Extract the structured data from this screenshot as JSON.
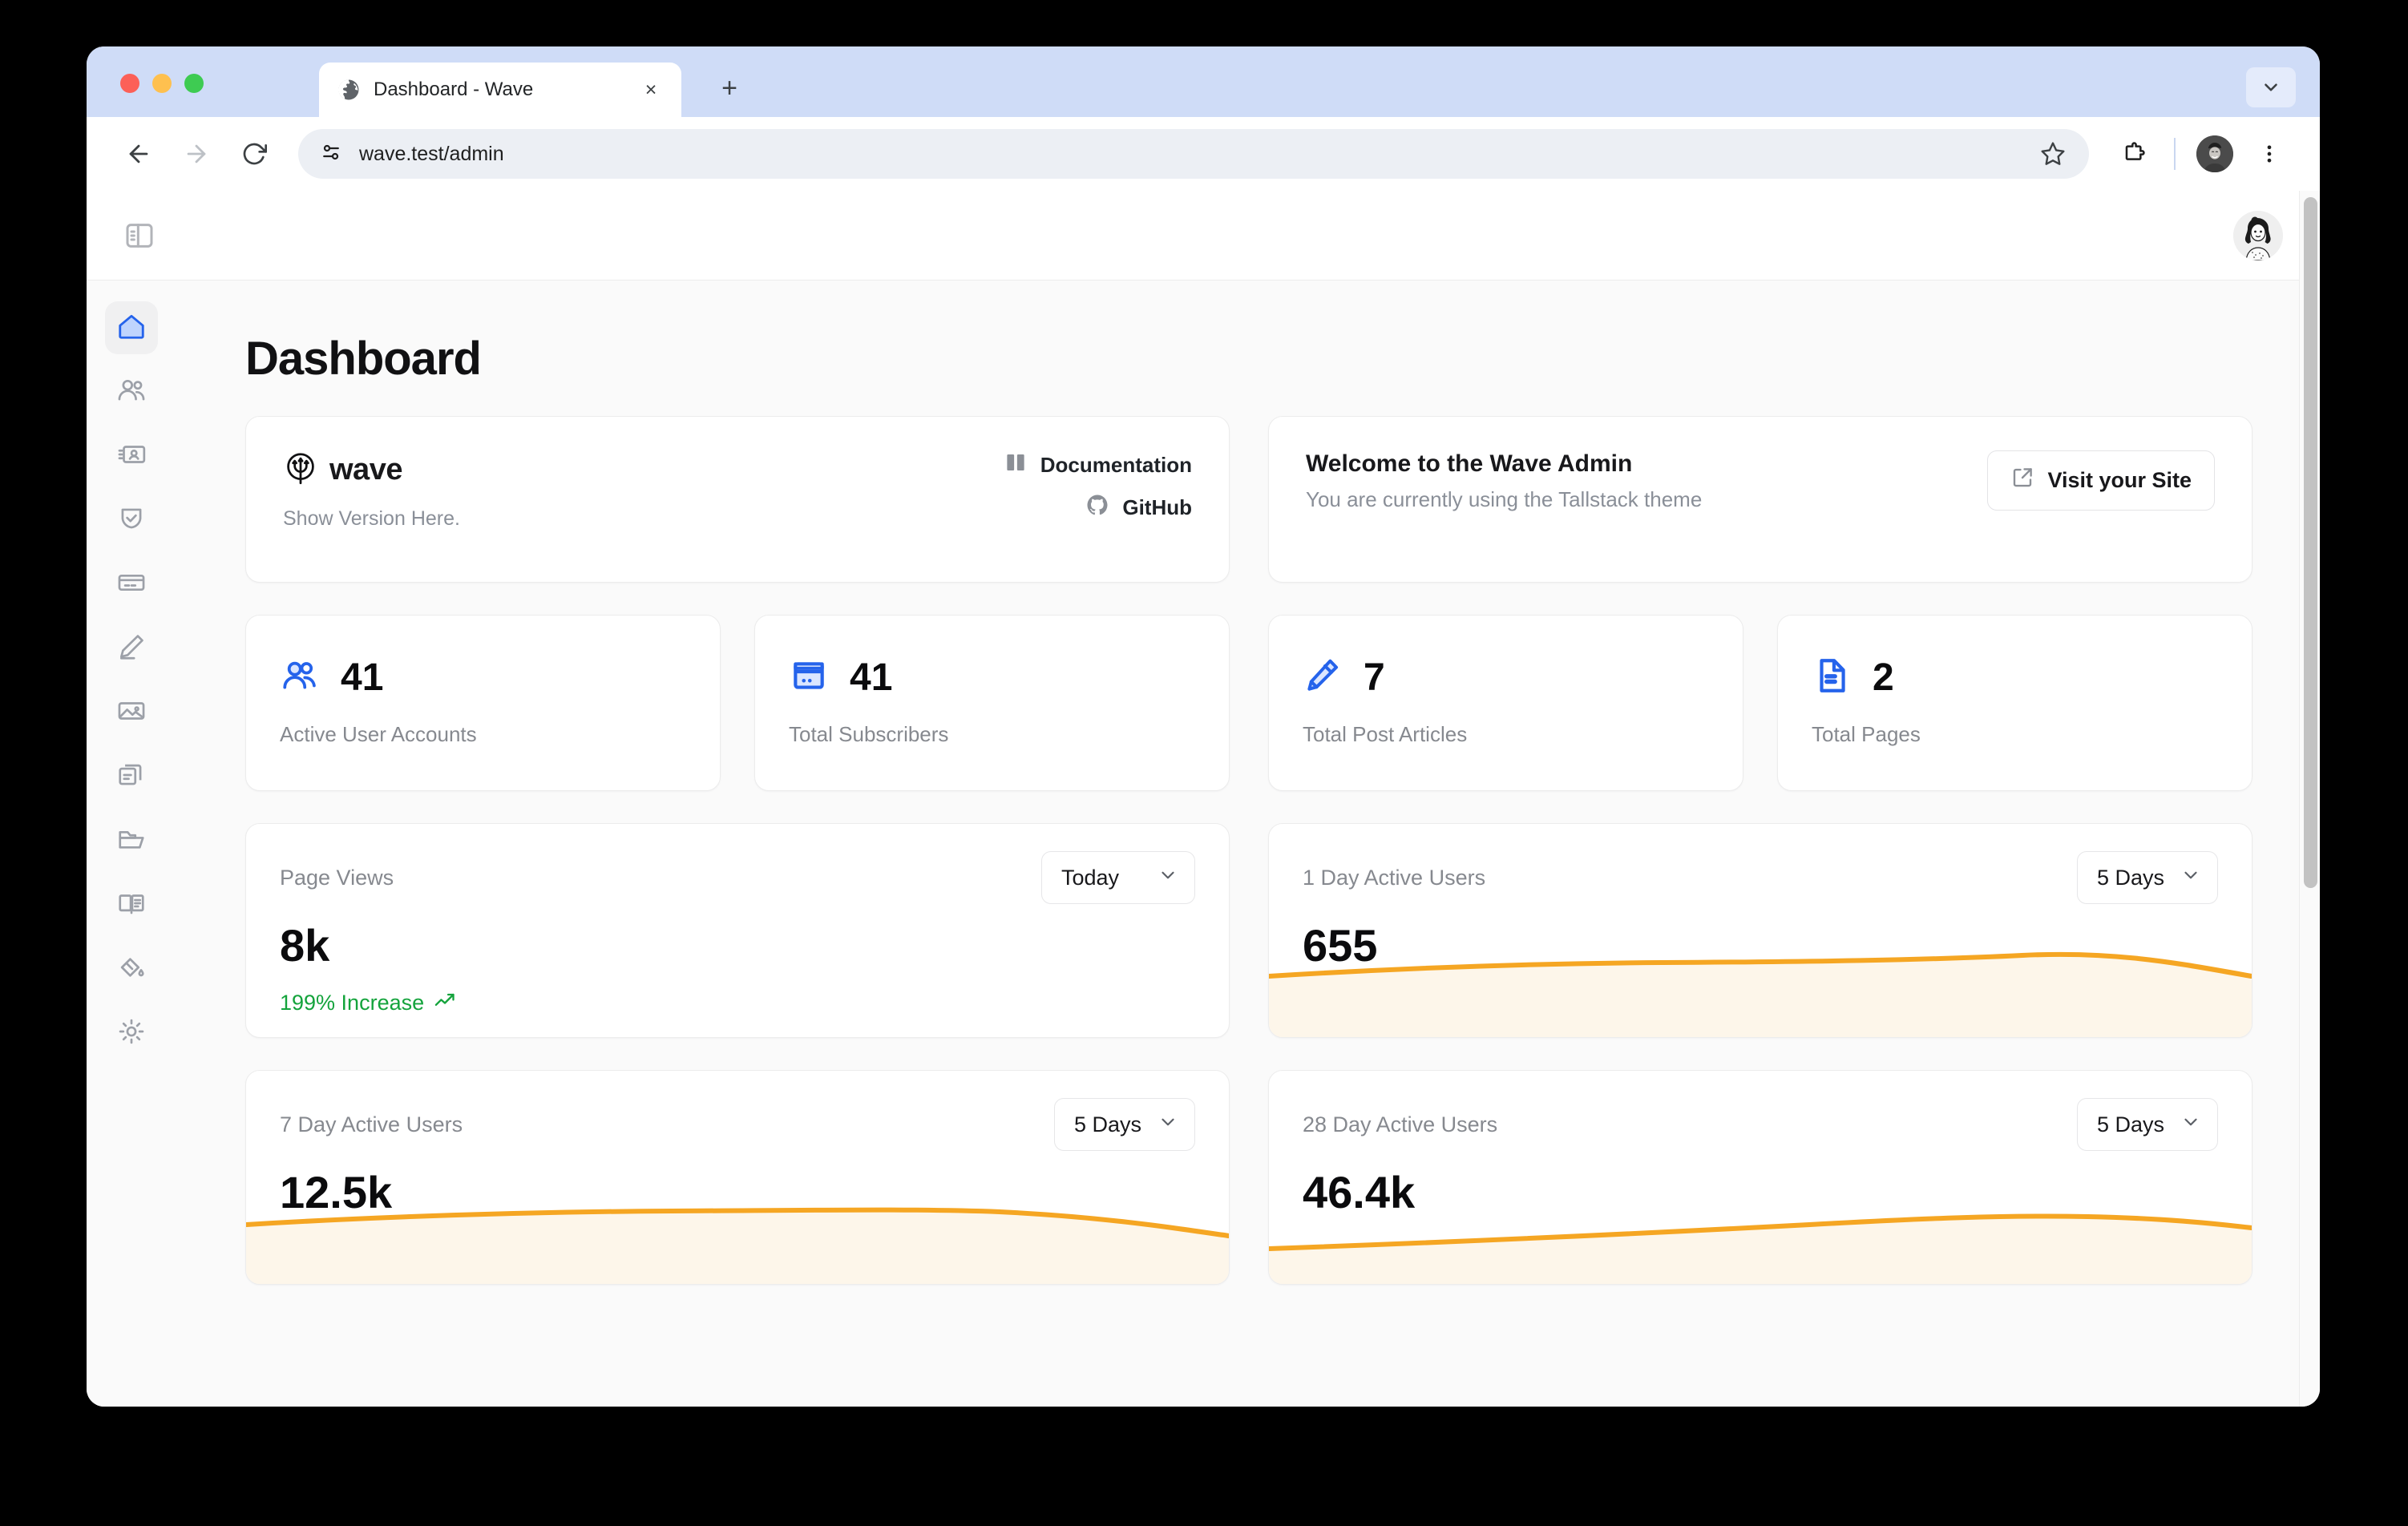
{
  "browser": {
    "tab": {
      "title": "Dashboard - Wave",
      "favicon": "globe-icon",
      "close": "×"
    },
    "new_tab": "+",
    "address": "wave.test/admin",
    "reload_glyph": "⟳",
    "back_glyph": "←",
    "forward_glyph": "→"
  },
  "app": {
    "topbar": {
      "panel_toggle_icon": "sidebar-toggle-icon",
      "avatar_alt": "User avatar"
    },
    "sidebar": {
      "items": [
        {
          "name": "home",
          "label": "Dashboard",
          "active": true
        },
        {
          "name": "users",
          "label": "Users",
          "active": false
        },
        {
          "name": "id-card",
          "label": "Profiles",
          "active": false
        },
        {
          "name": "shield-check",
          "label": "Roles",
          "active": false
        },
        {
          "name": "credit-card",
          "label": "Billing",
          "active": false
        },
        {
          "name": "pencil",
          "label": "Posts",
          "active": false
        },
        {
          "name": "image",
          "label": "Media",
          "active": false
        },
        {
          "name": "documents",
          "label": "Pages",
          "active": false
        },
        {
          "name": "folder",
          "label": "Categories",
          "active": false
        },
        {
          "name": "book-open",
          "label": "Docs",
          "active": false
        },
        {
          "name": "paint-bucket",
          "label": "Themes",
          "active": false
        },
        {
          "name": "gear",
          "label": "Settings",
          "active": false
        }
      ]
    },
    "page_title": "Dashboard",
    "brand_card": {
      "logo_icon": "wave-trident-logo",
      "name": "wave",
      "version": "Show Version Here.",
      "links": [
        {
          "icon": "book-icon",
          "label": "Documentation"
        },
        {
          "icon": "github-icon",
          "label": "GitHub"
        }
      ]
    },
    "welcome_card": {
      "title": "Welcome to the Wave Admin",
      "subtitle": "You are currently using the Tallstack theme",
      "button": {
        "icon": "external-link-icon",
        "label": "Visit your Site"
      }
    },
    "stats": [
      {
        "icon": "users-icon",
        "value": "41",
        "label": "Active User Accounts"
      },
      {
        "icon": "credit-card-icon",
        "value": "41",
        "label": "Total Subscribers"
      },
      {
        "icon": "pencil-icon",
        "value": "7",
        "label": "Total Post Articles"
      },
      {
        "icon": "document-icon",
        "value": "2",
        "label": "Total Pages"
      }
    ],
    "metrics": [
      {
        "label": "Page Views",
        "value": "8k",
        "delta": "199% Increase",
        "delta_icon": "trend-up-icon",
        "dropdown": "Today",
        "has_chart": false
      },
      {
        "label": "1 Day Active Users",
        "value": "655",
        "dropdown": "5 Days",
        "has_chart": true
      },
      {
        "label": "7 Day Active Users",
        "value": "12.5k",
        "dropdown": "5 Days",
        "has_chart": true
      },
      {
        "label": "28 Day Active Users",
        "value": "46.4k",
        "dropdown": "5 Days",
        "has_chart": true
      }
    ],
    "colors": {
      "accent": "#2563eb",
      "spark_line": "#f5a623",
      "spark_fill": "#fdf6ea",
      "positive": "#14a33c",
      "muted_text": "#86898f"
    }
  },
  "chart_data": [
    {
      "type": "line",
      "title": "1 Day Active Users",
      "x": [
        0,
        1,
        2,
        3,
        4
      ],
      "values": [
        640,
        660,
        668,
        672,
        620
      ],
      "series": [
        {
          "name": "1 Day Active Users",
          "values": [
            640,
            660,
            668,
            672,
            620
          ]
        }
      ],
      "xlabel": "",
      "ylabel": "",
      "grid": false,
      "legend": "none",
      "latest_value": 655,
      "range_label": "5 Days",
      "line_color": "#f5a623",
      "fill_color": "#fdf6ea"
    },
    {
      "type": "line",
      "title": "7 Day Active Users",
      "x": [
        0,
        1,
        2,
        3,
        4
      ],
      "values": [
        12200,
        12550,
        12600,
        12580,
        12100
      ],
      "series": [
        {
          "name": "7 Day Active Users",
          "values": [
            12200,
            12550,
            12600,
            12580,
            12100
          ]
        }
      ],
      "xlabel": "",
      "ylabel": "",
      "grid": false,
      "legend": "none",
      "latest_value": 12500,
      "range_label": "5 Days",
      "line_color": "#f5a623",
      "fill_color": "#fdf6ea"
    },
    {
      "type": "line",
      "title": "28 Day Active Users",
      "x": [
        0,
        1,
        2,
        3,
        4
      ],
      "values": [
        44800,
        45400,
        46100,
        46600,
        46400
      ],
      "series": [
        {
          "name": "28 Day Active Users",
          "values": [
            44800,
            45400,
            46100,
            46600,
            46400
          ]
        }
      ],
      "xlabel": "",
      "ylabel": "",
      "grid": false,
      "legend": "none",
      "latest_value": 46400,
      "range_label": "5 Days",
      "line_color": "#f5a623",
      "fill_color": "#fdf6ea"
    }
  ]
}
